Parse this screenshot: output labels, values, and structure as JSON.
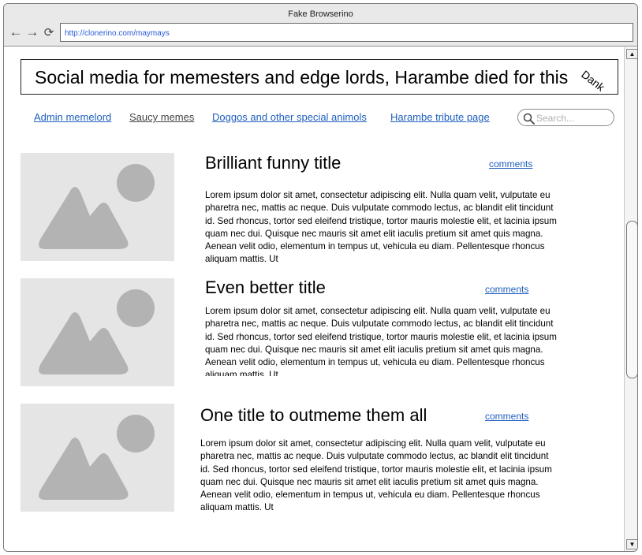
{
  "browser": {
    "window_title": "Fake Browserino",
    "url": "http://clonerino.com/maymays"
  },
  "site": {
    "title": "Social media for memesters and edge lords, Harambe died for this",
    "badge": "Dank"
  },
  "nav": {
    "links": [
      {
        "label": "Admin memelord"
      },
      {
        "label": "Saucy memes"
      },
      {
        "label": "Doggos and other special animols"
      },
      {
        "label": "Harambe tribute page"
      }
    ],
    "search_placeholder": "Search..."
  },
  "posts": [
    {
      "title": "Brilliant funny title",
      "comments_label": "comments",
      "body": "Lorem ipsum dolor sit amet, consectetur adipiscing elit. Nulla quam velit, vulputate eu pharetra nec, mattis ac neque. Duis vulputate commodo lectus, ac blandit elit tincidunt id. Sed rhoncus, tortor sed eleifend tristique, tortor mauris molestie elit, et lacinia ipsum quam nec dui. Quisque nec mauris sit amet elit iaculis pretium sit amet quis magna. Aenean velit odio, elementum in tempus ut, vehicula eu diam. Pellentesque rhoncus aliquam mattis. Ut"
    },
    {
      "title": "Even better title",
      "comments_label": "comments",
      "body": "Lorem ipsum dolor sit amet, consectetur adipiscing elit. Nulla quam velit, vulputate eu pharetra nec, mattis ac neque. Duis vulputate commodo lectus, ac blandit elit tincidunt id. Sed rhoncus, tortor sed eleifend tristique, tortor mauris molestie elit, et lacinia ipsum quam nec dui. Quisque nec mauris sit amet elit iaculis pretium sit amet quis magna. Aenean velit odio, elementum in tempus ut, vehicula eu diam. Pellentesque rhoncus aliquam mattis. Ut"
    },
    {
      "title": "One title to outmeme them all",
      "comments_label": "comments",
      "body": "Lorem ipsum dolor sit amet, consectetur adipiscing elit. Nulla quam velit, vulputate eu pharetra nec, mattis ac neque. Duis vulputate commodo lectus, ac blandit elit tincidunt id. Sed rhoncus, tortor sed eleifend tristique, tortor mauris molestie elit, et lacinia ipsum quam nec dui. Quisque nec mauris sit amet elit iaculis pretium sit amet quis magna. Aenean velit odio, elementum in tempus ut, vehicula eu diam. Pellentesque rhoncus aliquam mattis. Ut"
    }
  ],
  "icons": {
    "back": "back-arrow-icon",
    "forward": "forward-arrow-icon",
    "reload": "reload-icon",
    "search": "search-icon",
    "image_placeholder": "image-placeholder-icon",
    "scroll_up": "scroll-up-arrow-icon",
    "scroll_down": "scroll-down-arrow-icon"
  },
  "colors": {
    "link": "#1f5fbf",
    "placeholder_bg": "#e5e5e5",
    "placeholder_shape": "#b3b3b3",
    "chrome_bg": "#e9e9e9"
  }
}
